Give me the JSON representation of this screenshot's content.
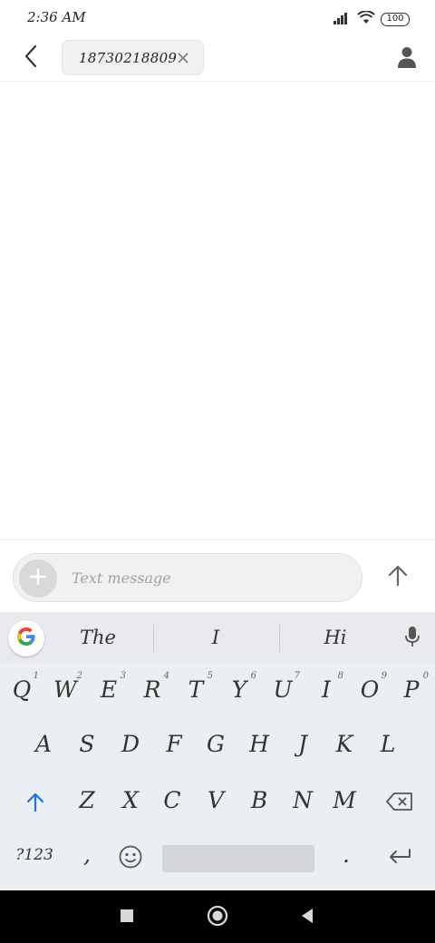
{
  "status_bar": {
    "time": "2:36 AM",
    "battery": "100",
    "icons": [
      "signal-icon",
      "wifi-icon",
      "battery-icon"
    ]
  },
  "header": {
    "back_icon": "back-arrow-icon",
    "recipient": "18730218809",
    "chip_close_icon": "close-icon",
    "contact_icon": "person-icon"
  },
  "compose": {
    "placeholder": "Text message",
    "value": "",
    "add_icon": "plus-icon",
    "send_icon": "arrow-up-icon"
  },
  "keyboard": {
    "suggestions": [
      "The",
      "I",
      "Hi"
    ],
    "row1": [
      {
        "key": "Q",
        "hint": "1"
      },
      {
        "key": "W",
        "hint": "2"
      },
      {
        "key": "E",
        "hint": "3"
      },
      {
        "key": "R",
        "hint": "4"
      },
      {
        "key": "T",
        "hint": "5"
      },
      {
        "key": "Y",
        "hint": "6"
      },
      {
        "key": "U",
        "hint": "7"
      },
      {
        "key": "I",
        "hint": "8"
      },
      {
        "key": "O",
        "hint": "9"
      },
      {
        "key": "P",
        "hint": "0"
      }
    ],
    "row2": [
      "A",
      "S",
      "D",
      "F",
      "G",
      "H",
      "J",
      "K",
      "L"
    ],
    "row3": [
      "Z",
      "X",
      "C",
      "V",
      "B",
      "N",
      "M"
    ],
    "symbols_label": "?123",
    "comma": ",",
    "period": "."
  },
  "colors": {
    "accent_blue": "#1a73e8",
    "keyboard_bg": "#eceff1",
    "nav_bg": "#000000"
  }
}
